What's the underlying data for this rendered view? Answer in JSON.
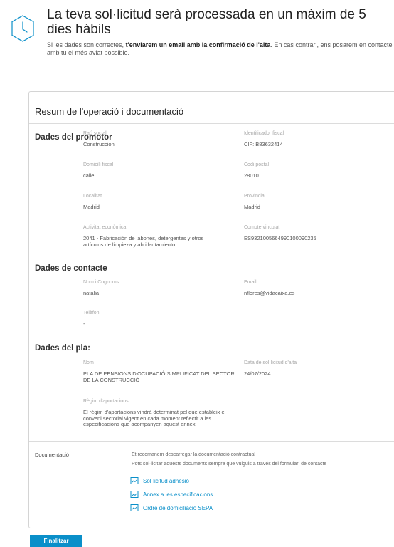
{
  "header": {
    "title": "La teva sol·licitud serà processada en un màxim de 5 dies hàbils",
    "intro_prefix": "Si les dades son correctes, ",
    "intro_bold": "t'enviarem un email amb la confirmació de l'alta",
    "intro_suffix": ". En cas contrari, ens posarem en contacte amb tu el més aviat possible."
  },
  "summary": {
    "title": "Resum de l'operació i documentació",
    "promotor": {
      "heading": "Dades del promotor",
      "fields": [
        {
          "label": "Raó social",
          "value": "Construccion"
        },
        {
          "label": "Identificador fiscal",
          "value": "CIF: B83632414"
        },
        {
          "label": "Domicili fiscal",
          "value": "calle"
        },
        {
          "label": "Codi postal",
          "value": "28010"
        },
        {
          "label": "Localitat",
          "value": "Madrid"
        },
        {
          "label": "Provincia",
          "value": "Madrid"
        },
        {
          "label": "Activitat econòmica",
          "value": "2041 - Fabricación de jabones, detergentes y otros artículos de limpieza y abrillantamiento"
        },
        {
          "label": "Compte vinculat",
          "value": "ES9321005664990100090235"
        }
      ]
    },
    "contacte": {
      "heading": "Dades de contacte",
      "fields": [
        {
          "label": "Nom i Cognoms",
          "value": "natalia"
        },
        {
          "label": "Email",
          "value": "nflores@vidacaixa.es"
        },
        {
          "label": "Telèfon",
          "value": "-"
        }
      ]
    },
    "pla": {
      "heading": "Dades del pla:",
      "fields": [
        {
          "label": "Nom",
          "value": "PLA DE PENSIONS D'OCUPACIÓ SIMPLIFICAT DEL SECTOR DE LA CONSTRUCCIÓ"
        },
        {
          "label": "Data de sol·licitud d'alta",
          "value": "24/07/2024"
        },
        {
          "label": "Règim d'aportacions",
          "value": "El règim d'aportacions vindrà determinat pel que estableix el conveni sectorial vigent en cada moment reflectit a les especificacions que acompanyen aquest annex"
        }
      ]
    },
    "documentacio": {
      "heading": "Documentació",
      "info1": "Et recomanem descarregar la documentació contractual",
      "info2": "Pots sol·licitar aquests documents sempre que vulguis a través del formulari de contacte",
      "links": [
        "Sol·licitud adhesió",
        "Annex a les especificacions",
        "Ordre de domiciliació SEPA"
      ]
    }
  },
  "actions": {
    "finish_label": "Finalitzar"
  },
  "colors": {
    "accent": "#0a8fc9"
  }
}
